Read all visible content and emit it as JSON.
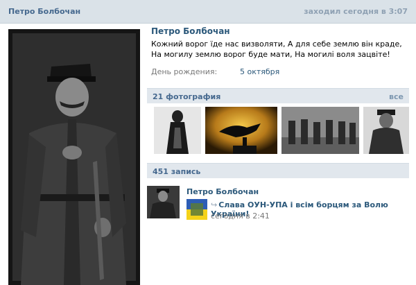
{
  "header": {
    "name": "Петро Болбочан",
    "last_seen": "заходил сегодня в 3:07"
  },
  "profile": {
    "name": "Петро Болбочан",
    "status": "Кожний ворог їде нас визволяти, А для себе землю він краде, На могилу землю ворог будe мати, На могилі воля зацвіте!",
    "birthday_label": "День рождения:",
    "birthday_value": "5 октября"
  },
  "photos": {
    "title": "21 фотография",
    "all_label": "все",
    "items": [
      {
        "name": "photo-cossack"
      },
      {
        "name": "photo-raven"
      },
      {
        "name": "photo-soldiers"
      },
      {
        "name": "photo-officer"
      }
    ]
  },
  "wall": {
    "title": "451 запись",
    "post": {
      "author": "Петро Болбочан",
      "text": "Слава ОУН-УПА і всім борцям за Волю України!",
      "share_icon": "share-icon",
      "time": "сегодня в 2:41"
    }
  }
}
